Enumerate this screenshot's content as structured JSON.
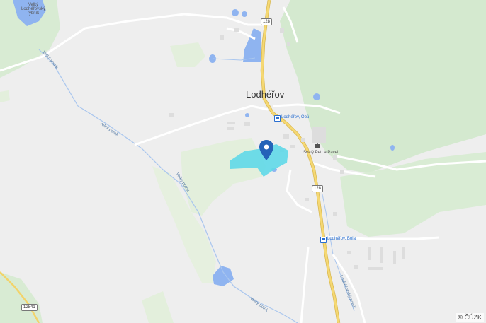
{
  "map": {
    "town_name": "Lodhéřov",
    "pond_label": "Velký Lodhéřovský rybník",
    "poi_church": "Svatý Petr a Pavel",
    "bus_stop_1": "Lodhéřov, Obú",
    "bus_stop_2": "Lodhéřov, Bola",
    "stream_1": "Velký potok",
    "stream_2": "Velký potok",
    "stream_3": "Velký potok",
    "stream_4": "Lodhéřovský potok",
    "road_128_a": "128",
    "road_128_b": "128",
    "road_12841": "12841",
    "copyright": "© ČÚZK",
    "marker_icon": "location-pin-icon",
    "colors": {
      "background": "#eeeeee",
      "forest": "#d4e9cf",
      "field": "#e3efdc",
      "water": "#8fb4f0",
      "highlight": "#5fd8e8",
      "main_road": "#f2d36b",
      "pin": "#2463b8"
    }
  }
}
